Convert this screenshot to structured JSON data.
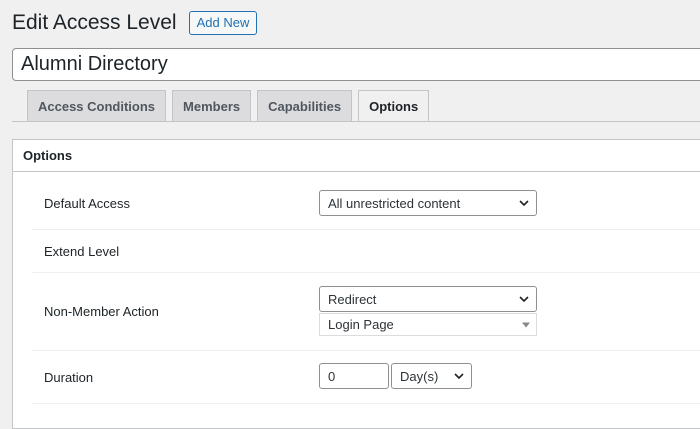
{
  "header": {
    "title": "Edit Access Level",
    "add_new_label": "Add New"
  },
  "title_field": {
    "value": "Alumni Directory"
  },
  "tabs": [
    {
      "label": "Access Conditions",
      "active": false
    },
    {
      "label": "Members",
      "active": false
    },
    {
      "label": "Capabilities",
      "active": false
    },
    {
      "label": "Options",
      "active": true
    }
  ],
  "panel": {
    "title": "Options",
    "default_access": {
      "label": "Default Access",
      "selected": "All unrestricted content"
    },
    "extend_level": {
      "label": "Extend Level"
    },
    "non_member_action": {
      "label": "Non-Member Action",
      "selected": "Redirect",
      "target_selected": "Login Page"
    },
    "duration": {
      "label": "Duration",
      "value": "0",
      "unit": "Day(s)"
    }
  },
  "icons": {
    "select_arrow": "chevron-down-icon",
    "secondary_select_arrow": "triangle-down-icon"
  }
}
